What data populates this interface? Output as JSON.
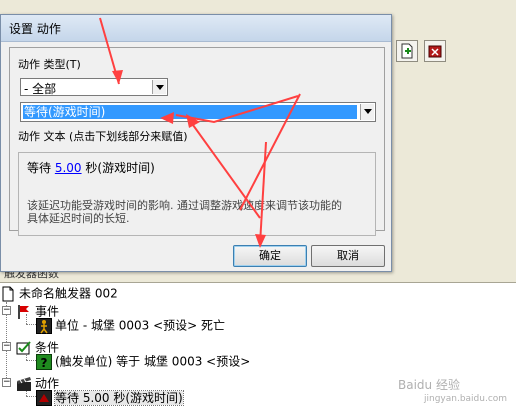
{
  "dialog": {
    "title": "设置 动作",
    "action_type_label": "动作 类型(T)",
    "action_type_value": "- 全部",
    "action_value": "等待(游戏时间)",
    "action_text_label": "动作 文本 (点击下划线部分来赋值)",
    "action_text_prefix": "等待",
    "action_text_link": "5.00",
    "action_text_suffix": "秒(游戏时间)",
    "description_line1": "该延迟功能受游戏时间的影响. 通过调整游戏速度来调节该功能的",
    "description_line2": "具体延迟时间的长短.",
    "ok_label": "确定",
    "cancel_label": "取消"
  },
  "background": {
    "strip_label": "触发器函数"
  },
  "tree": {
    "trigger_name": "未命名触发器 002",
    "events_label": "事件",
    "event_item": "单位 - 城堡 0003 <预设> 死亡",
    "conditions_label": "条件",
    "condition_item": "(触发单位) 等于 城堡 0003 <预设>",
    "actions_label": "动作",
    "action_item": "等待 5.00 秒(游戏时间)"
  },
  "watermark": {
    "text": "Baidu 经验",
    "sub": "jingyan.baidu.com"
  },
  "colors": {
    "selection": "#3399ff",
    "annotation_arrow": "#ff4040",
    "link": "#0000ff"
  }
}
